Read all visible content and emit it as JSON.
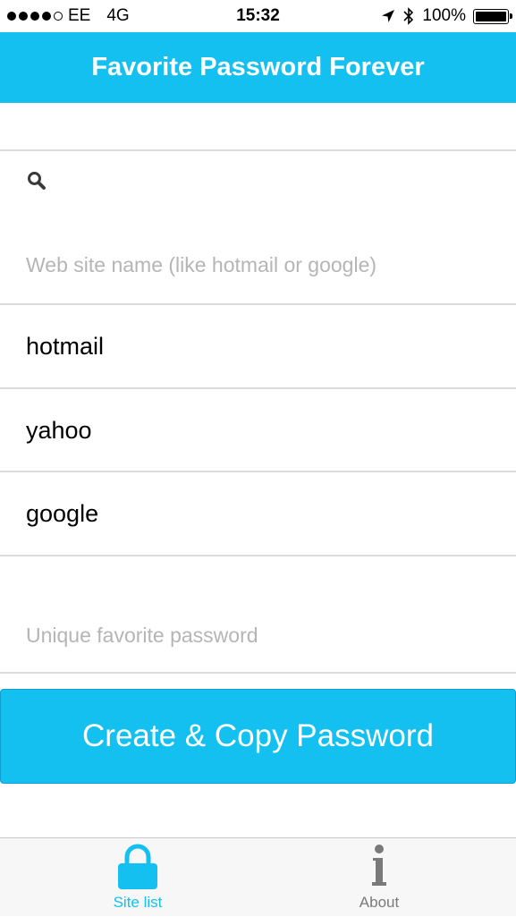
{
  "status_bar": {
    "carrier": "EE",
    "network": "4G",
    "time": "15:32",
    "battery": "100%"
  },
  "nav": {
    "title": "Favorite Password Forever"
  },
  "search": {
    "icon": "search-icon",
    "placeholder": "Web site name (like hotmail or google)"
  },
  "sites": [
    {
      "label": "hotmail"
    },
    {
      "label": "yahoo"
    },
    {
      "label": "google"
    }
  ],
  "password": {
    "placeholder": "Unique favorite password"
  },
  "create_button": {
    "label": "Create & Copy Password"
  },
  "tabs": [
    {
      "label": "Site list",
      "icon": "lock-icon",
      "active": true
    },
    {
      "label": "About",
      "icon": "info-icon",
      "active": false
    }
  ],
  "colors": {
    "accent": "#14c0f0",
    "inactive_tab": "#7a7a7a",
    "separator": "#dcdcdc",
    "placeholder": "#b5b5b5"
  }
}
